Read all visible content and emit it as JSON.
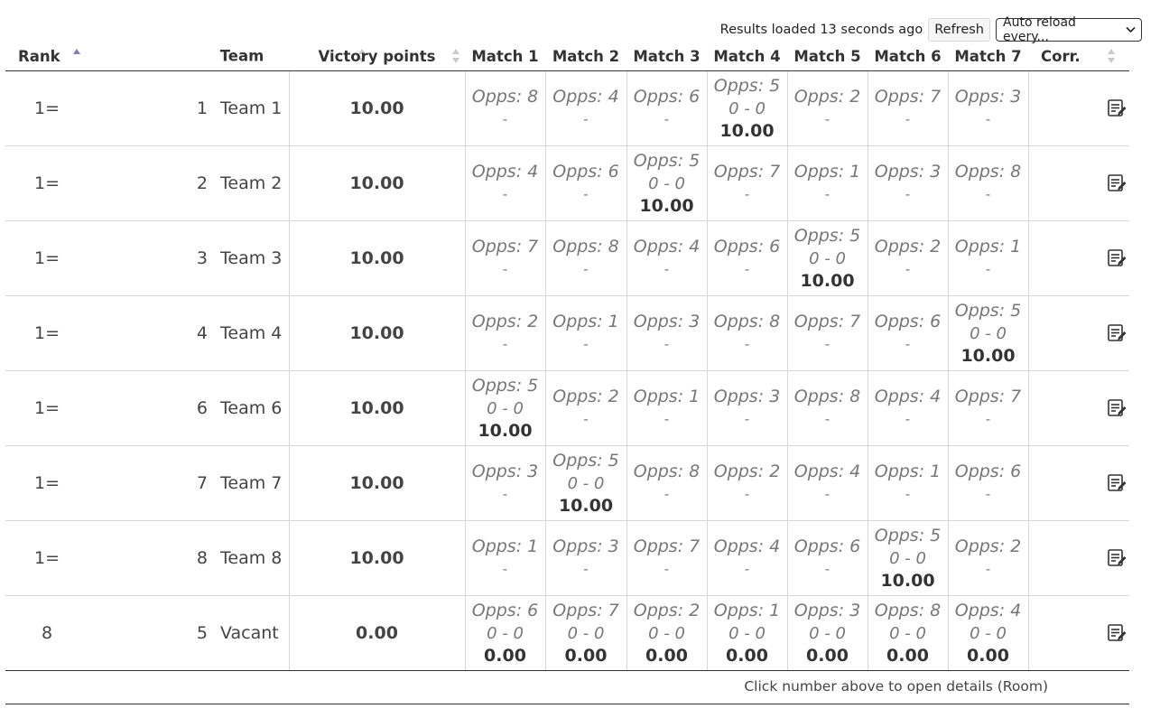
{
  "toolbar": {
    "status": "Results loaded 13 seconds ago",
    "refresh_label": "Refresh",
    "auto_reload": "Auto reload every..."
  },
  "table": {
    "headers": {
      "rank": "Rank",
      "team": "Team",
      "vp": "Victory points",
      "matches": [
        "Match 1",
        "Match 2",
        "Match 3",
        "Match 4",
        "Match 5",
        "Match 6",
        "Match 7"
      ],
      "corr": "Corr."
    },
    "sort": {
      "column": "Rank",
      "direction": "ascending"
    },
    "rows": [
      {
        "rank": "1=",
        "num": "1",
        "name": "Team 1",
        "vp": "10.00",
        "matches": [
          {
            "opp": "Opps: 8",
            "score": "",
            "pts": ""
          },
          {
            "opp": "Opps: 4",
            "score": "",
            "pts": ""
          },
          {
            "opp": "Opps: 6",
            "score": "",
            "pts": ""
          },
          {
            "opp": "Opps: 5",
            "score": "0 - 0",
            "pts": "10.00"
          },
          {
            "opp": "Opps: 2",
            "score": "",
            "pts": ""
          },
          {
            "opp": "Opps: 7",
            "score": "",
            "pts": ""
          },
          {
            "opp": "Opps: 3",
            "score": "",
            "pts": ""
          }
        ]
      },
      {
        "rank": "1=",
        "num": "2",
        "name": "Team 2",
        "vp": "10.00",
        "matches": [
          {
            "opp": "Opps: 4",
            "score": "",
            "pts": ""
          },
          {
            "opp": "Opps: 6",
            "score": "",
            "pts": ""
          },
          {
            "opp": "Opps: 5",
            "score": "0 - 0",
            "pts": "10.00"
          },
          {
            "opp": "Opps: 7",
            "score": "",
            "pts": ""
          },
          {
            "opp": "Opps: 1",
            "score": "",
            "pts": ""
          },
          {
            "opp": "Opps: 3",
            "score": "",
            "pts": ""
          },
          {
            "opp": "Opps: 8",
            "score": "",
            "pts": ""
          }
        ]
      },
      {
        "rank": "1=",
        "num": "3",
        "name": "Team 3",
        "vp": "10.00",
        "matches": [
          {
            "opp": "Opps: 7",
            "score": "",
            "pts": ""
          },
          {
            "opp": "Opps: 8",
            "score": "",
            "pts": ""
          },
          {
            "opp": "Opps: 4",
            "score": "",
            "pts": ""
          },
          {
            "opp": "Opps: 6",
            "score": "",
            "pts": ""
          },
          {
            "opp": "Opps: 5",
            "score": "0 - 0",
            "pts": "10.00"
          },
          {
            "opp": "Opps: 2",
            "score": "",
            "pts": ""
          },
          {
            "opp": "Opps: 1",
            "score": "",
            "pts": ""
          }
        ]
      },
      {
        "rank": "1=",
        "num": "4",
        "name": "Team 4",
        "vp": "10.00",
        "matches": [
          {
            "opp": "Opps: 2",
            "score": "",
            "pts": ""
          },
          {
            "opp": "Opps: 1",
            "score": "",
            "pts": ""
          },
          {
            "opp": "Opps: 3",
            "score": "",
            "pts": ""
          },
          {
            "opp": "Opps: 8",
            "score": "",
            "pts": ""
          },
          {
            "opp": "Opps: 7",
            "score": "",
            "pts": ""
          },
          {
            "opp": "Opps: 6",
            "score": "",
            "pts": ""
          },
          {
            "opp": "Opps: 5",
            "score": "0 - 0",
            "pts": "10.00"
          }
        ]
      },
      {
        "rank": "1=",
        "num": "6",
        "name": "Team 6",
        "vp": "10.00",
        "matches": [
          {
            "opp": "Opps: 5",
            "score": "0 - 0",
            "pts": "10.00"
          },
          {
            "opp": "Opps: 2",
            "score": "",
            "pts": ""
          },
          {
            "opp": "Opps: 1",
            "score": "",
            "pts": ""
          },
          {
            "opp": "Opps: 3",
            "score": "",
            "pts": ""
          },
          {
            "opp": "Opps: 8",
            "score": "",
            "pts": ""
          },
          {
            "opp": "Opps: 4",
            "score": "",
            "pts": ""
          },
          {
            "opp": "Opps: 7",
            "score": "",
            "pts": ""
          }
        ]
      },
      {
        "rank": "1=",
        "num": "7",
        "name": "Team 7",
        "vp": "10.00",
        "matches": [
          {
            "opp": "Opps: 3",
            "score": "",
            "pts": ""
          },
          {
            "opp": "Opps: 5",
            "score": "0 - 0",
            "pts": "10.00"
          },
          {
            "opp": "Opps: 8",
            "score": "",
            "pts": ""
          },
          {
            "opp": "Opps: 2",
            "score": "",
            "pts": ""
          },
          {
            "opp": "Opps: 4",
            "score": "",
            "pts": ""
          },
          {
            "opp": "Opps: 1",
            "score": "",
            "pts": ""
          },
          {
            "opp": "Opps: 6",
            "score": "",
            "pts": ""
          }
        ]
      },
      {
        "rank": "1=",
        "num": "8",
        "name": "Team 8",
        "vp": "10.00",
        "matches": [
          {
            "opp": "Opps: 1",
            "score": "",
            "pts": ""
          },
          {
            "opp": "Opps: 3",
            "score": "",
            "pts": ""
          },
          {
            "opp": "Opps: 7",
            "score": "",
            "pts": ""
          },
          {
            "opp": "Opps: 4",
            "score": "",
            "pts": ""
          },
          {
            "opp": "Opps: 6",
            "score": "",
            "pts": ""
          },
          {
            "opp": "Opps: 5",
            "score": "0 - 0",
            "pts": "10.00"
          },
          {
            "opp": "Opps: 2",
            "score": "",
            "pts": ""
          }
        ]
      },
      {
        "rank": "8",
        "num": "5",
        "name": "Vacant",
        "vp": "0.00",
        "matches": [
          {
            "opp": "Opps: 6",
            "score": "0 - 0",
            "pts": "0.00"
          },
          {
            "opp": "Opps: 7",
            "score": "0 - 0",
            "pts": "0.00"
          },
          {
            "opp": "Opps: 2",
            "score": "0 - 0",
            "pts": "0.00"
          },
          {
            "opp": "Opps: 1",
            "score": "0 - 0",
            "pts": "0.00"
          },
          {
            "opp": "Opps: 3",
            "score": "0 - 0",
            "pts": "0.00"
          },
          {
            "opp": "Opps: 8",
            "score": "0 - 0",
            "pts": "0.00"
          },
          {
            "opp": "Opps: 4",
            "score": "0 - 0",
            "pts": "0.00"
          }
        ]
      }
    ],
    "no_result_mark": "-",
    "corr_icon": "edit-note-icon"
  },
  "footer": {
    "hint": "Click number above to open details (Room)"
  }
}
